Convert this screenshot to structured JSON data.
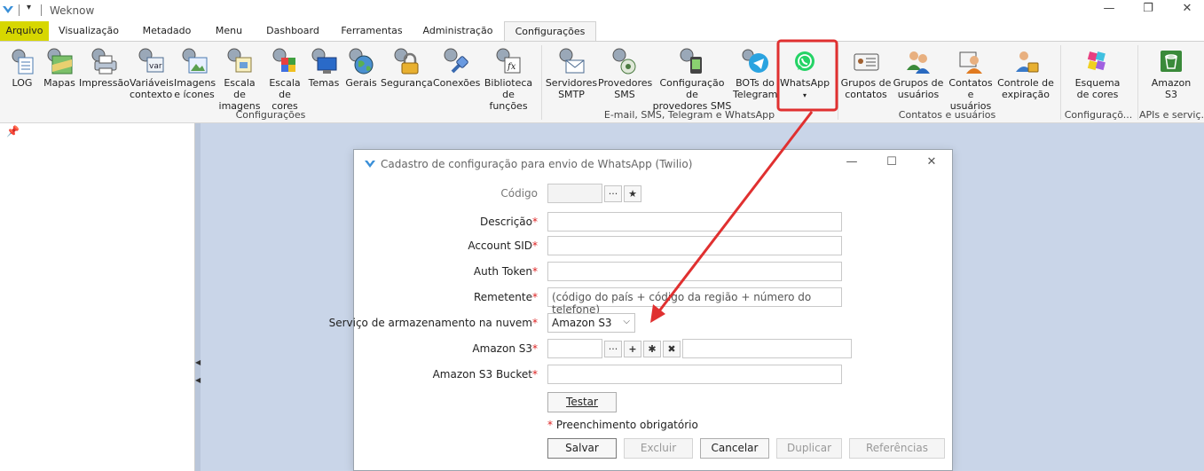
{
  "window": {
    "title": "Weknow",
    "minimize_glyph": "—",
    "restore_glyph": "❐",
    "close_glyph": "✕",
    "qa_glyph": "▾"
  },
  "tabs": [
    {
      "label": "Arquivo"
    },
    {
      "label": "Visualização"
    },
    {
      "label": "Metadado"
    },
    {
      "label": "Menu"
    },
    {
      "label": "Dashboard"
    },
    {
      "label": "Ferramentas"
    },
    {
      "label": "Administração"
    },
    {
      "label": "Configurações"
    }
  ],
  "ribbon": {
    "groups": [
      {
        "label": "Configurações"
      },
      {
        "label": "E-mail, SMS, Telegram e WhatsApp"
      },
      {
        "label": "Contatos e usuários"
      },
      {
        "label": "Configuraçõ..."
      },
      {
        "label": "APIs e serviç..."
      }
    ],
    "buttons": [
      {
        "line1": "LOG",
        "line2": "",
        "icon": "log-icon"
      },
      {
        "line1": "Mapas",
        "line2": "",
        "icon": "map-icon"
      },
      {
        "line1": "Impressão",
        "line2": "",
        "icon": "printer-icon"
      },
      {
        "line1": "Variáveis",
        "line2": "contexto",
        "icon": "variables-icon"
      },
      {
        "line1": "Imagens",
        "line2": "e ícones",
        "icon": "images-icon"
      },
      {
        "line1": "Escala de",
        "line2": "imagens",
        "icon": "image-scale-icon"
      },
      {
        "line1": "Escala",
        "line2": "de cores",
        "icon": "color-scale-icon"
      },
      {
        "line1": "Temas",
        "line2": "",
        "icon": "themes-icon"
      },
      {
        "line1": "Gerais",
        "line2": "",
        "icon": "globe-icon"
      },
      {
        "line1": "Segurança",
        "line2": "",
        "icon": "lock-icon"
      },
      {
        "line1": "Conexões",
        "line2": "",
        "icon": "connections-icon"
      },
      {
        "line1": "Biblioteca",
        "line2": "de funções",
        "icon": "function-library-icon"
      },
      {
        "line1": "Servidores",
        "line2": "SMTP",
        "icon": "smtp-icon"
      },
      {
        "line1": "Provedores",
        "line2": "SMS",
        "icon": "sms-icon"
      },
      {
        "line1": "Configuração de",
        "line2": "provedores SMS",
        "icon": "sms-config-icon"
      },
      {
        "line1": "BOTs do",
        "line2": "Telegram",
        "icon": "telegram-icon"
      },
      {
        "line1": "WhatsApp",
        "line2": "▾",
        "icon": "whatsapp-icon"
      },
      {
        "line1": "Grupos de",
        "line2": "contatos",
        "icon": "contact-groups-icon"
      },
      {
        "line1": "Grupos de",
        "line2": "usuários",
        "icon": "user-groups-icon"
      },
      {
        "line1": "Contatos",
        "line2": "e usuários",
        "icon": "contacts-icon"
      },
      {
        "line1": "Controle de",
        "line2": "expiração",
        "icon": "expiration-icon"
      },
      {
        "line1": "Esquema",
        "line2": "de cores",
        "icon": "color-scheme-icon"
      },
      {
        "line1": "Amazon",
        "line2": "S3",
        "icon": "amazon-s3-icon"
      }
    ]
  },
  "dialog": {
    "title": "Cadastro de configuração para envio de WhatsApp (Twilio)",
    "fields": {
      "codigo": {
        "label": "Código",
        "value": ""
      },
      "descricao": {
        "label": "Descrição",
        "value": ""
      },
      "account_sid": {
        "label": "Account SID",
        "value": ""
      },
      "auth_token": {
        "label": "Auth Token",
        "value": ""
      },
      "remetente": {
        "label": "Remetente",
        "placeholder": "(código do país + código da região + número do telefone)"
      },
      "servico": {
        "label": "Serviço de armazenamento na nuvem",
        "selected": "Amazon S3"
      },
      "amazon_s3": {
        "label": "Amazon S3",
        "value": ""
      },
      "bucket": {
        "label": "Amazon S3 Bucket",
        "value": ""
      }
    },
    "required_mark": "*",
    "required_note": "Preenchimento obrigatório",
    "buttons": {
      "testar": "Testar",
      "salvar": "Salvar",
      "excluir": "Excluir",
      "cancelar": "Cancelar",
      "duplicar": "Duplicar",
      "referencias": "Referências"
    },
    "glyphs": {
      "ellipsis": "···",
      "star": "★",
      "plus": "+",
      "asterisk": "✱",
      "close": "✖"
    }
  },
  "colors": {
    "file_tab": "#d7d700",
    "highlight_box": "#e03030",
    "annotation_arrow": "#e03030",
    "workspace": "#c9d5e8",
    "whatsapp": "#25d366"
  }
}
